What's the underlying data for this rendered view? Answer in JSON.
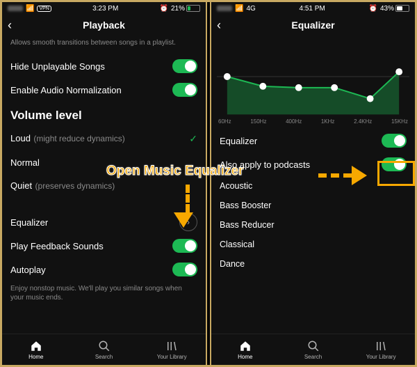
{
  "annotation": {
    "text": "Open Music Equalizer"
  },
  "left": {
    "status": {
      "indicator": "VPN",
      "time": "3:23 PM",
      "battery": "21%"
    },
    "title": "Playback",
    "desc_crossfade": "Allows smooth transitions between songs in a playlist.",
    "rows": {
      "hide": "Hide Unplayable Songs",
      "norm": "Enable Audio Normalization",
      "loud": "Loud",
      "loud_hint": "(might reduce dynamics)",
      "normal": "Normal",
      "quiet": "Quiet",
      "quiet_hint": "(preserves dynamics)",
      "equalizer": "Equalizer",
      "feedback": "Play Feedback Sounds",
      "autoplay": "Autoplay"
    },
    "section_volume": "Volume level",
    "desc_autoplay": "Enjoy nonstop music. We'll play you similar songs when your music ends.",
    "tabs": {
      "home": "Home",
      "search": "Search",
      "library": "Your Library"
    }
  },
  "right": {
    "status": {
      "carrier": "4G",
      "time": "4:51 PM",
      "battery": "43%"
    },
    "title": "Equalizer",
    "bands": [
      "60Hz",
      "150Hz",
      "400Hz",
      "1KHz",
      "2.4KHz",
      "15KHz"
    ],
    "rows": {
      "equalizer": "Equalizer",
      "podcasts": "Also apply to podcasts"
    },
    "presets": [
      "Acoustic",
      "Bass Booster",
      "Bass Reducer",
      "Classical",
      "Dance"
    ],
    "tabs": {
      "home": "Home",
      "search": "Search",
      "library": "Your Library"
    }
  },
  "chart_data": {
    "type": "line",
    "title": "Equalizer",
    "xlabel": "",
    "ylabel": "",
    "categories": [
      "60Hz",
      "150Hz",
      "400Hz",
      "1KHz",
      "2.4KHz",
      "15KHz"
    ],
    "values": [
      0.0,
      -1.5,
      -1.8,
      -1.8,
      -3.5,
      0.8
    ],
    "ylim": [
      -6,
      6
    ]
  }
}
